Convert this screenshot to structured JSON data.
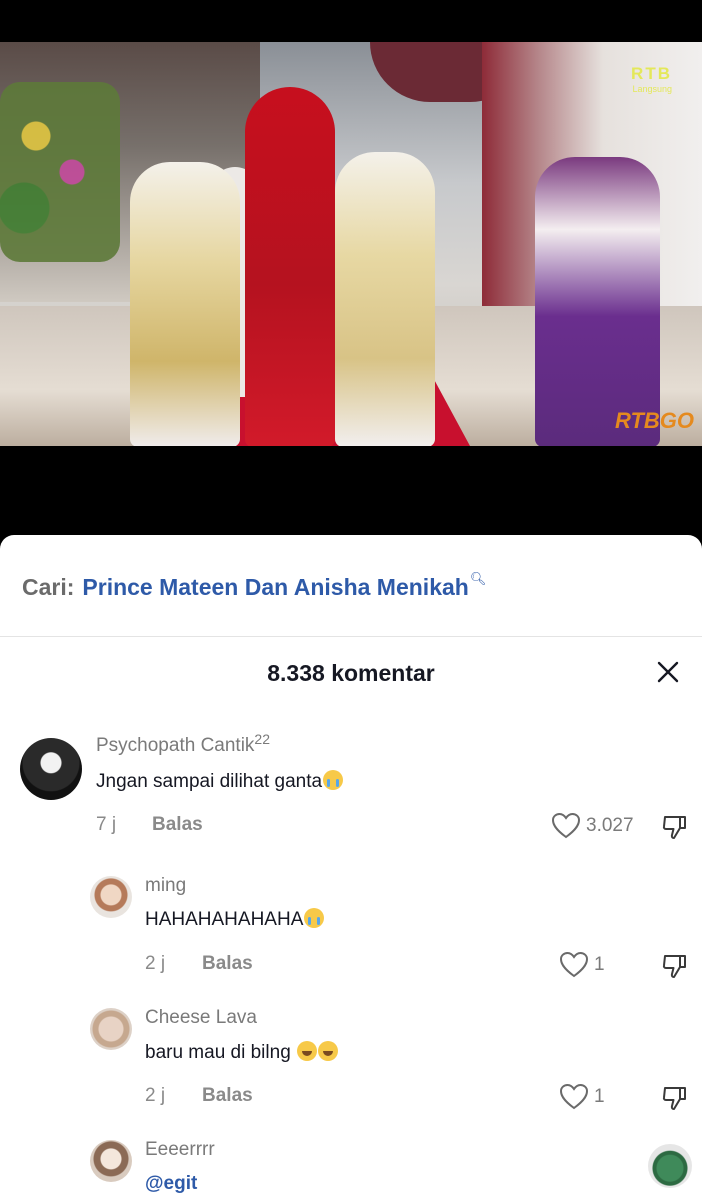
{
  "video": {
    "logo_top": "RTB",
    "logo_top_sub": "Langsung",
    "logo_bottom": "RTBGO"
  },
  "search": {
    "prefix": "Cari:",
    "query": "Prince Mateen Dan Anisha Menikah"
  },
  "header": {
    "comment_count": "8.338 komentar"
  },
  "comments": [
    {
      "username": "Psychopath Cantik",
      "username_sup": "22",
      "text": "Jngan sampai dilihat ganta",
      "emoji": [
        "cry"
      ],
      "time": "7 j",
      "reply_label": "Balas",
      "likes": "3.027"
    },
    {
      "username": "ming",
      "text": "HAHAHAHAHAHA",
      "emoji": [
        "cry"
      ],
      "time": "2 j",
      "reply_label": "Balas",
      "likes": "1"
    },
    {
      "username": "Cheese Lava",
      "text": "baru mau di bilng ",
      "emoji": [
        "laugh",
        "laugh"
      ],
      "time": "2 j",
      "reply_label": "Balas",
      "likes": "1"
    },
    {
      "username": "Eeeerrrr",
      "text": "@egit"
    }
  ],
  "colors": {
    "accent_blue": "#2e5aa8",
    "muted_text": "#7a7a7a",
    "primary_text": "#161823"
  }
}
